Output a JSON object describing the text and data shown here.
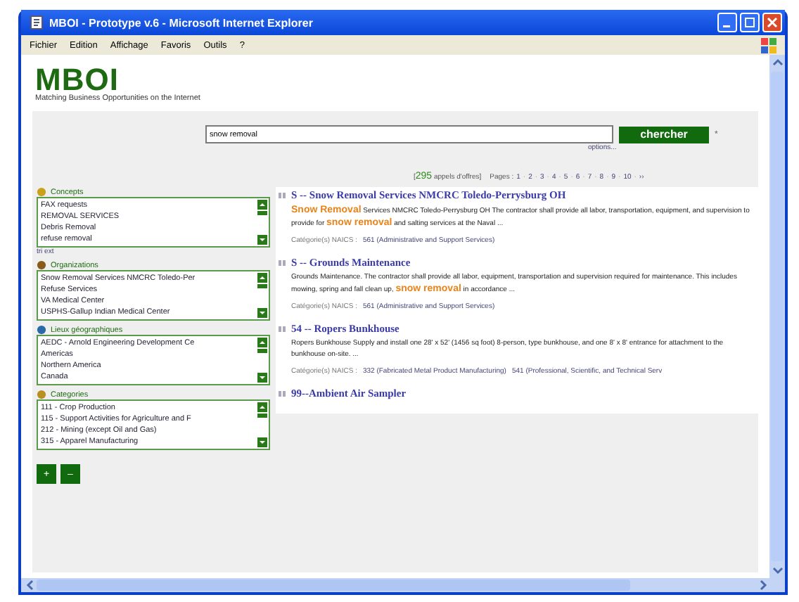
{
  "window": {
    "title": "MBOI - Prototype v.6 - Microsoft Internet Explorer"
  },
  "menu": [
    "Fichier",
    "Edition",
    "Affichage",
    "Favoris",
    "Outils",
    "?"
  ],
  "site": {
    "logo": "MBOI",
    "tagline": "Matching Business Opportunities on the Internet"
  },
  "search": {
    "value": "snow removal",
    "button": "chercher",
    "mark": "*",
    "options": "options..."
  },
  "facets": [
    {
      "kind": "concepts",
      "title": "Concepts",
      "items": [
        "FAX requests",
        "REMOVAL SERVICES",
        "Debris Removal",
        "refuse removal"
      ],
      "link": "tri ext"
    },
    {
      "kind": "organizations",
      "title": "Organizations",
      "items": [
        "Snow Removal Services NMCRC Toledo-Per",
        "Refuse Services",
        "VA Medical Center",
        "USPHS-Gallup Indian Medical Center"
      ]
    },
    {
      "kind": "places",
      "title": "Lieux géographiques",
      "items": [
        "AEDC - Arnold Engineering Development Ce",
        "Americas",
        "Northern America",
        "Canada"
      ]
    },
    {
      "kind": "categories",
      "title": "Categories",
      "items": [
        "111 - Crop Production",
        "115 - Support Activities for Agriculture and F",
        "212 - Mining (except Oil and Gas)",
        "315 - Apparel Manufacturing"
      ]
    }
  ],
  "facet_buttons": [
    "+",
    "–"
  ],
  "results_bar": {
    "count": "295",
    "count_label": "appels d'offres]",
    "open": "[",
    "pages_label": "Pages :",
    "separator": "·",
    "pages": [
      "1",
      "2",
      "3",
      "4",
      "5",
      "6",
      "7",
      "8",
      "9",
      "10",
      "››"
    ]
  },
  "results": [
    {
      "title": "S -- Snow Removal Services NMCRC Toledo-Perrysburg OH",
      "description": [
        {
          "text": "Snow Removal",
          "highlight": true
        },
        {
          "text": " Services NMCRC Toledo-Perrysburg OH The contractor shall provide all labor, transportation, equipment, and supervision to provide for ",
          "highlight": false
        },
        {
          "text": "snow removal",
          "highlight": true
        },
        {
          "text": " and salting services at the Naval ...",
          "highlight": false
        }
      ],
      "category_label": "Catégorie(s) NAICS :",
      "categories": [
        "561 (Administrative and Support Services)"
      ]
    },
    {
      "title": "S -- Grounds Maintenance",
      "description": [
        {
          "text": "Grounds Maintenance. The contractor shall provide all labor, equipment, transportation and supervision required for maintenance. This includes mowing, spring and fall clean up, ",
          "highlight": false
        },
        {
          "text": "snow removal",
          "highlight": true
        },
        {
          "text": " in accordance ...",
          "highlight": false
        }
      ],
      "category_label": "Catégorie(s) NAICS :",
      "categories": [
        "561 (Administrative and Support Services)"
      ]
    },
    {
      "title": "54 -- Ropers Bunkhouse",
      "description": [
        {
          "text": "Ropers Bunkhouse Supply and install one 28' x 52' (1456 sq foot) 8-person, type bunkhouse, and one 8' x 8' entrance for attachment to the bunkhouse on-site. ...",
          "highlight": false
        }
      ],
      "category_label": "Catégorie(s) NAICS :",
      "categories": [
        "332 (Fabricated Metal Product Manufacturing)",
        "541 (Professional, Scientific, and Technical Serv"
      ]
    },
    {
      "title": "99--Ambient Air Sampler"
    }
  ]
}
